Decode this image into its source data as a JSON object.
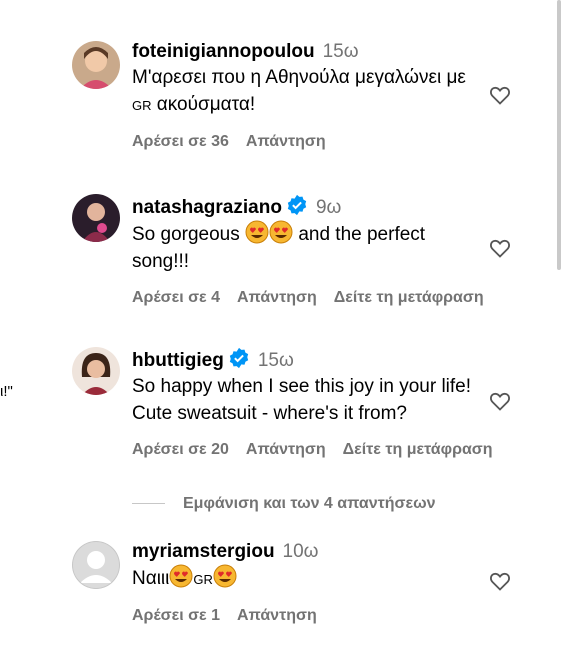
{
  "left_fragment": "ι!\"",
  "top_fragment": "",
  "comments": [
    {
      "username": "foteinigiannopoulou",
      "time": "15ω",
      "verified": false,
      "text_parts": [
        "Μ'αρεσει που η Αθηνούλα μεγαλώνει με ",
        "GR",
        " ακούσματα!"
      ],
      "likes": "Αρέσει σε 36",
      "reply": "Απάντηση",
      "translate": ""
    },
    {
      "username": "natashagraziano",
      "time": "9ω",
      "verified": true,
      "text_parts": [
        "So gorgeous ",
        "and the perfect song!!!"
      ],
      "likes": "Αρέσει σε 4",
      "reply": "Απάντηση",
      "translate": "Δείτε τη μετάφραση"
    },
    {
      "username": "hbuttigieg",
      "time": "15ω",
      "verified": true,
      "text": "So happy when I see this joy in your life! Cute sweatsuit - where's it from?",
      "likes": "Αρέσει σε 20",
      "reply": "Απάντηση",
      "translate": "Δείτε τη μετάφραση"
    },
    {
      "username": "myriamstergiou",
      "time": "10ω",
      "verified": false,
      "text_parts": [
        "Ναιιι",
        "GR"
      ],
      "likes": "Αρέσει σε 1",
      "reply": "Απάντηση",
      "translate": ""
    }
  ],
  "view_replies": "Εμφάνιση και των 4 απαντήσεων",
  "icons": {
    "like": "heart-outline-icon",
    "verified": "verified-badge-icon",
    "emoji": "heart-eyes-emoji"
  },
  "colors": {
    "verified": "#0095f6",
    "secondary": "#737373"
  }
}
